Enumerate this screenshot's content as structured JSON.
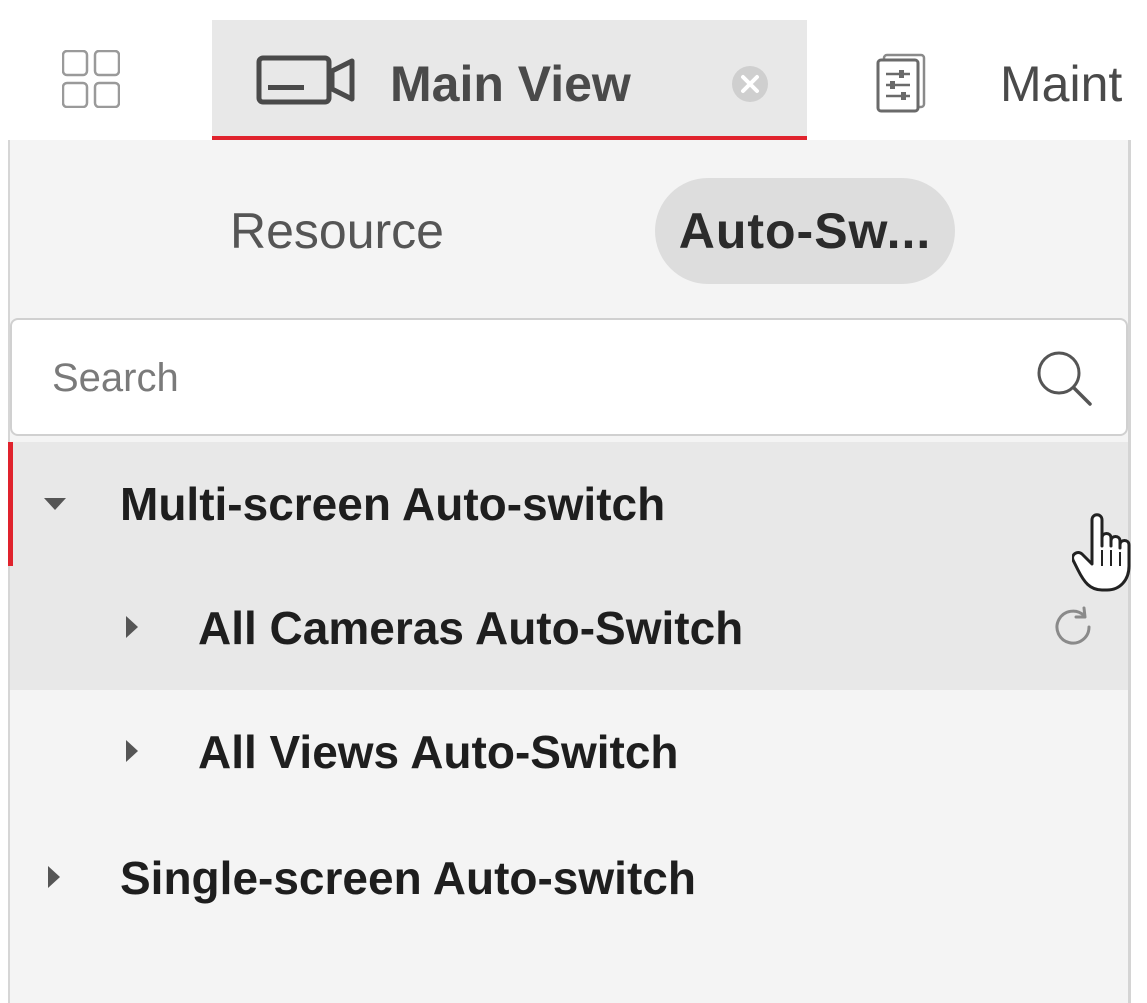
{
  "topbar": {
    "home_icon": "grid-icon",
    "tabs": [
      {
        "label": "Main View",
        "icon": "camera-icon",
        "active": true,
        "closable": true
      },
      {
        "label": "Maint",
        "icon": "settings-sliders-icon",
        "active": false
      }
    ]
  },
  "panel": {
    "subtabs": [
      {
        "label": "Resource",
        "selected": false
      },
      {
        "label": "Auto-Sw...",
        "selected": true
      }
    ],
    "search": {
      "placeholder": "Search",
      "value": "",
      "icon": "search-icon"
    },
    "tree": [
      {
        "label": "Multi-screen Auto-switch",
        "expanded": true,
        "level": 0
      },
      {
        "label": "All Cameras Auto-Switch",
        "expanded": false,
        "level": 1,
        "action_icon": "refresh-icon"
      },
      {
        "label": "All Views Auto-Switch",
        "expanded": false,
        "level": 1
      },
      {
        "label": "Single-screen Auto-switch",
        "expanded": false,
        "level": 0
      }
    ]
  },
  "colors": {
    "accent": "#e0232d",
    "active_tab_bg": "#e8e8e8",
    "panel_bg": "#f4f4f4",
    "text_dark": "#1e1e1e"
  }
}
